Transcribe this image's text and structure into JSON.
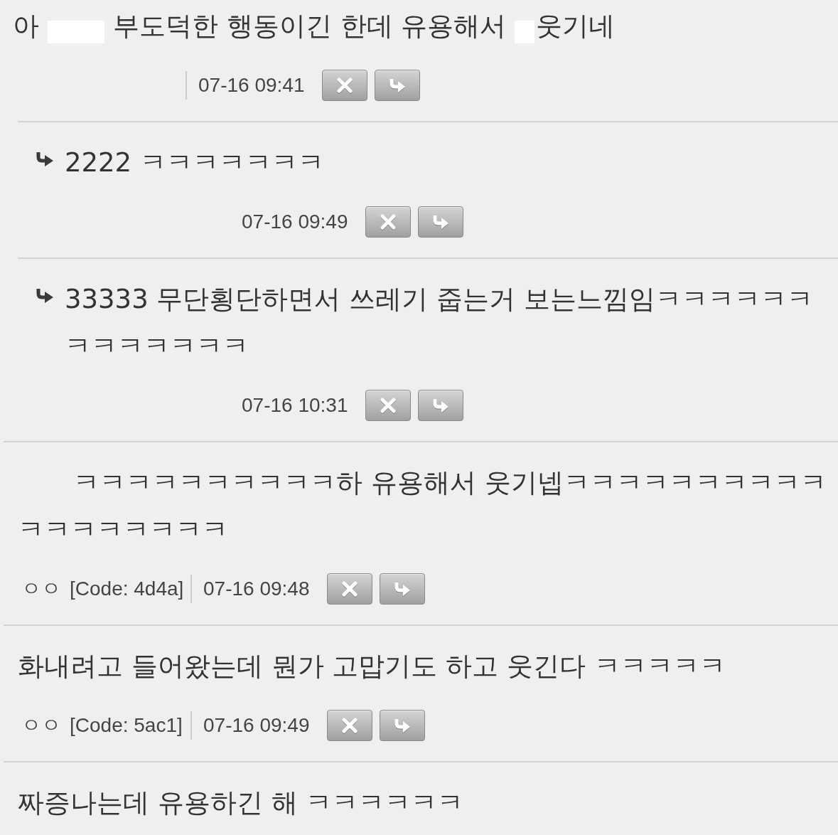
{
  "comments": [
    {
      "kind": "comment",
      "indented": false,
      "segments": [
        {
          "kind": "text",
          "text": "아"
        },
        {
          "kind": "redacted_word"
        },
        {
          "kind": "text",
          "text": "부도덕한 행동이긴 한데 유용해서"
        },
        {
          "kind": "redacted_letter"
        },
        {
          "kind": "text",
          "text": "웃기네"
        }
      ],
      "date": "07-16 09:41"
    },
    {
      "kind": "reply",
      "indented": false,
      "segments": [
        {
          "kind": "text",
          "text": "2222 ㅋㅋㅋㅋㅋㅋㅋ"
        }
      ],
      "date": "07-16 09:49"
    },
    {
      "kind": "reply",
      "indented": false,
      "segments": [
        {
          "kind": "text",
          "text": "33333 무단횡단하면서 쓰레기 줍는거 보는느낌임ㅋㅋㅋㅋㅋㅋㅋㅋㅋㅋㅋㅋㅋ"
        }
      ],
      "date": "07-16 10:31"
    },
    {
      "kind": "comment",
      "indented": true,
      "segments": [
        {
          "kind": "text",
          "text": "ㅋㅋㅋㅋㅋㅋㅋㅋㅋㅋ하 유용해서 웃기넵ㅋㅋㅋㅋㅋㅋㅋㅋㅋㅋㅋㅋㅋㅋㅋㅋㅋㅋ"
        }
      ],
      "author": "ㅇㅇ",
      "code": "[Code: 4d4a]",
      "date": "07-16 09:48"
    },
    {
      "kind": "comment",
      "indented": false,
      "segments": [
        {
          "kind": "text",
          "text": "화내려고 들어왔는데 뭔가 고맙기도 하고 웃긴다 ㅋㅋㅋㅋㅋ"
        }
      ],
      "author": "ㅇㅇ",
      "code": "[Code: 5ac1]",
      "date": "07-16 09:49"
    },
    {
      "kind": "comment",
      "indented": false,
      "segments": [
        {
          "kind": "text",
          "text": "짜증나는데 유용하긴 해 ㅋㅋㅋㅋㅋㅋ"
        }
      ]
    }
  ]
}
